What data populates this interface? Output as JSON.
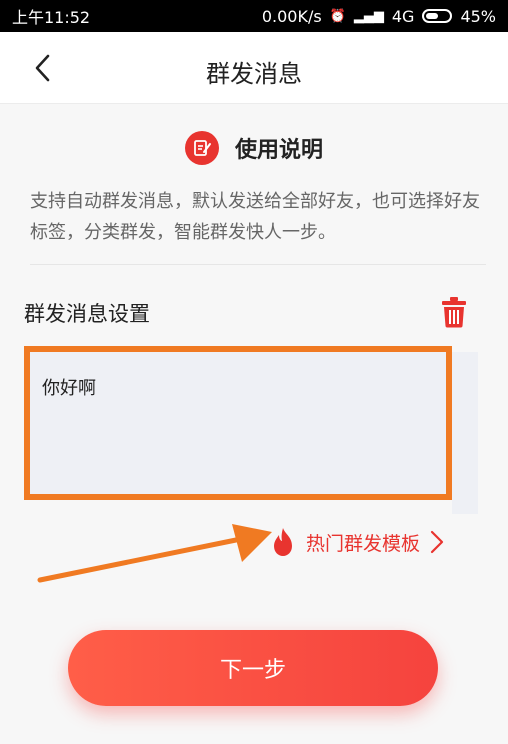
{
  "status_bar": {
    "time": "上午11:52",
    "speed": "0.00K/s",
    "network": "4G",
    "battery": "45%"
  },
  "nav": {
    "title": "群发消息"
  },
  "instructions": {
    "title": "使用说明",
    "text": "支持自动群发消息，默认发送给全部好友，也可选择好友标签，分类群发，智能群发快人一步。"
  },
  "settings": {
    "title": "群发消息设置",
    "message": "你好啊"
  },
  "hot_template": {
    "label": "热门群发模板"
  },
  "next_button": {
    "label": "下一步"
  },
  "colors": {
    "accent": "#e8342f",
    "highlight": "#f07a22"
  }
}
